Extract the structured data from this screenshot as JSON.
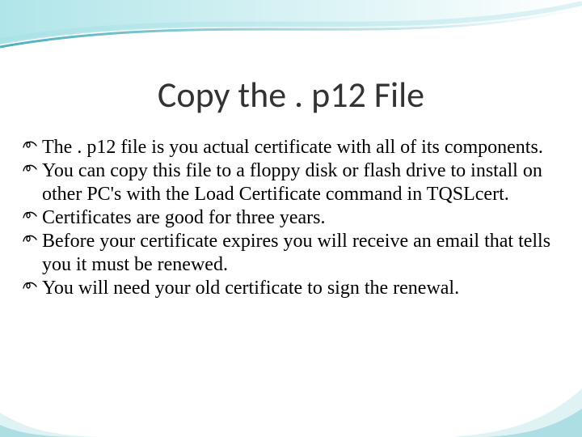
{
  "title": "Copy the . p12 File",
  "bullets": [
    "The . p12 file is you actual certificate with all of its components.",
    "You can copy this file to a floppy disk or flash drive to install on other PC's with the Load Certificate command in TQSLcert.",
    "Certificates are good for three years.",
    "Before your certificate expires you will receive an email that tells you it must be renewed.",
    "You will need your old certificate to sign the renewal."
  ]
}
